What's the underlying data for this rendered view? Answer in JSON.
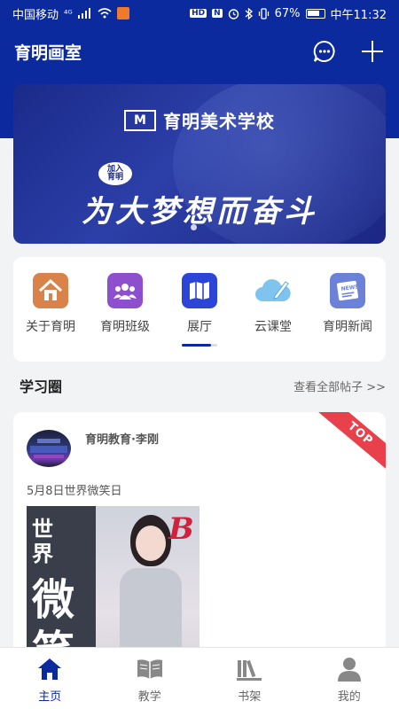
{
  "status_bar": {
    "carrier": "中国移动",
    "network": "⁴ᴳ",
    "hd_badge": "HD",
    "n_badge": "N",
    "battery": "67%",
    "time": "中午11:32"
  },
  "app_bar": {
    "title": "育明画室",
    "icons": [
      "chat-bubble-icon",
      "plus-icon"
    ]
  },
  "banner": {
    "logo": "M",
    "school_name": "育明美术学校",
    "tag": "加入\n育明",
    "slogan": "为大梦想而奋斗"
  },
  "menu": {
    "items": [
      {
        "label": "关于育明",
        "icon": "home-icon",
        "color": "#d9824a"
      },
      {
        "label": "育明班级",
        "icon": "class-group-icon",
        "color": "#8e4fcf"
      },
      {
        "label": "展厅",
        "icon": "map-icon",
        "color": "#2b46d6"
      },
      {
        "label": "云课堂",
        "icon": "cloud-edit-icon",
        "color": "#7fc4ee"
      },
      {
        "label": "育明新闻",
        "icon": "news-icon",
        "color": "#6c82d8"
      }
    ]
  },
  "section": {
    "title": "学习圈",
    "link": "查看全部帖子 >>"
  },
  "post": {
    "author": "育明教育·李刚",
    "badge": "TOP",
    "text": "5月8日世界微笑日",
    "image_words": [
      "世",
      "界",
      "微",
      "笑"
    ],
    "image_letter": "B"
  },
  "tab_bar": {
    "tabs": [
      {
        "label": "主页",
        "icon": "home-tab-icon",
        "active": true
      },
      {
        "label": "教学",
        "icon": "book-open-icon",
        "active": false
      },
      {
        "label": "书架",
        "icon": "bookshelf-icon",
        "active": false
      },
      {
        "label": "我的",
        "icon": "user-icon",
        "active": false
      }
    ]
  },
  "colors": {
    "primary": "#0a2a9e",
    "top_badge": "#e8414c"
  }
}
